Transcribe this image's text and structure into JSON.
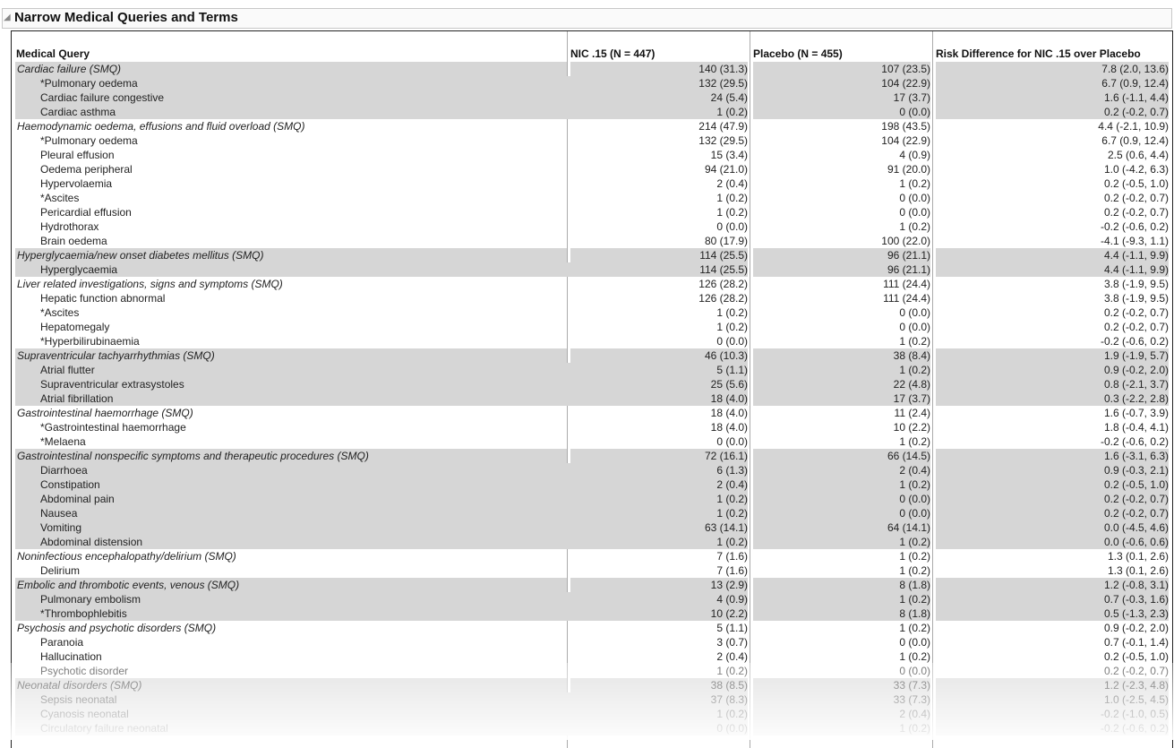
{
  "title": "Narrow Medical Queries and Terms",
  "headers": {
    "query": "Medical Query",
    "nic": "NIC .15 (N = 447)",
    "placebo": "Placebo (N = 455)",
    "risk": "Risk Difference for NIC .15 over Placebo"
  },
  "groups": [
    {
      "name": "Cardiac failure (SMQ)",
      "v": [
        "140 (31.3)",
        "107 (23.5)",
        "7.8 (2.0, 13.6)"
      ],
      "terms": [
        [
          "*Pulmonary oedema",
          "132 (29.5)",
          "104 (22.9)",
          "6.7 (0.9, 12.4)"
        ],
        [
          "Cardiac failure congestive",
          "24 (5.4)",
          "17 (3.7)",
          "1.6 (-1.1, 4.4)"
        ],
        [
          "Cardiac asthma",
          "1 (0.2)",
          "0 (0.0)",
          "0.2 (-0.2, 0.7)"
        ]
      ]
    },
    {
      "name": "Haemodynamic oedema, effusions and fluid overload (SMQ)",
      "v": [
        "214 (47.9)",
        "198 (43.5)",
        "4.4 (-2.1, 10.9)"
      ],
      "terms": [
        [
          "*Pulmonary oedema",
          "132 (29.5)",
          "104 (22.9)",
          "6.7 (0.9, 12.4)"
        ],
        [
          "Pleural effusion",
          "15 (3.4)",
          "4 (0.9)",
          "2.5 (0.6, 4.4)"
        ],
        [
          "Oedema peripheral",
          "94 (21.0)",
          "91 (20.0)",
          "1.0 (-4.2, 6.3)"
        ],
        [
          "Hypervolaemia",
          "2 (0.4)",
          "1 (0.2)",
          "0.2 (-0.5, 1.0)"
        ],
        [
          "*Ascites",
          "1 (0.2)",
          "0 (0.0)",
          "0.2 (-0.2, 0.7)"
        ],
        [
          "Pericardial effusion",
          "1 (0.2)",
          "0 (0.0)",
          "0.2 (-0.2, 0.7)"
        ],
        [
          "Hydrothorax",
          "0 (0.0)",
          "1 (0.2)",
          "-0.2 (-0.6, 0.2)"
        ],
        [
          "Brain oedema",
          "80 (17.9)",
          "100 (22.0)",
          "-4.1 (-9.3, 1.1)"
        ]
      ]
    },
    {
      "name": "Hyperglycaemia/new onset diabetes mellitus (SMQ)",
      "v": [
        "114 (25.5)",
        "96 (21.1)",
        "4.4 (-1.1, 9.9)"
      ],
      "terms": [
        [
          "Hyperglycaemia",
          "114 (25.5)",
          "96 (21.1)",
          "4.4 (-1.1, 9.9)"
        ]
      ]
    },
    {
      "name": "Liver related investigations, signs and symptoms (SMQ)",
      "v": [
        "126 (28.2)",
        "111 (24.4)",
        "3.8 (-1.9, 9.5)"
      ],
      "terms": [
        [
          "Hepatic function abnormal",
          "126 (28.2)",
          "111 (24.4)",
          "3.8 (-1.9, 9.5)"
        ],
        [
          "*Ascites",
          "1 (0.2)",
          "0 (0.0)",
          "0.2 (-0.2, 0.7)"
        ],
        [
          "Hepatomegaly",
          "1 (0.2)",
          "0 (0.0)",
          "0.2 (-0.2, 0.7)"
        ],
        [
          "*Hyperbilirubinaemia",
          "0 (0.0)",
          "1 (0.2)",
          "-0.2 (-0.6, 0.2)"
        ]
      ]
    },
    {
      "name": "Supraventricular tachyarrhythmias (SMQ)",
      "v": [
        "46 (10.3)",
        "38 (8.4)",
        "1.9 (-1.9, 5.7)"
      ],
      "terms": [
        [
          "Atrial flutter",
          "5 (1.1)",
          "1 (0.2)",
          "0.9 (-0.2, 2.0)"
        ],
        [
          "Supraventricular extrasystoles",
          "25 (5.6)",
          "22 (4.8)",
          "0.8 (-2.1, 3.7)"
        ],
        [
          "Atrial fibrillation",
          "18 (4.0)",
          "17 (3.7)",
          "0.3 (-2.2, 2.8)"
        ]
      ]
    },
    {
      "name": "Gastrointestinal haemorrhage (SMQ)",
      "v": [
        "18 (4.0)",
        "11 (2.4)",
        "1.6 (-0.7, 3.9)"
      ],
      "terms": [
        [
          "*Gastrointestinal haemorrhage",
          "18 (4.0)",
          "10 (2.2)",
          "1.8 (-0.4, 4.1)"
        ],
        [
          "*Melaena",
          "0 (0.0)",
          "1 (0.2)",
          "-0.2 (-0.6, 0.2)"
        ]
      ]
    },
    {
      "name": "Gastrointestinal nonspecific symptoms and therapeutic procedures (SMQ)",
      "v": [
        "72 (16.1)",
        "66 (14.5)",
        "1.6 (-3.1, 6.3)"
      ],
      "terms": [
        [
          "Diarrhoea",
          "6 (1.3)",
          "2 (0.4)",
          "0.9 (-0.3, 2.1)"
        ],
        [
          "Constipation",
          "2 (0.4)",
          "1 (0.2)",
          "0.2 (-0.5, 1.0)"
        ],
        [
          "Abdominal pain",
          "1 (0.2)",
          "0 (0.0)",
          "0.2 (-0.2, 0.7)"
        ],
        [
          "Nausea",
          "1 (0.2)",
          "0 (0.0)",
          "0.2 (-0.2, 0.7)"
        ],
        [
          "Vomiting",
          "63 (14.1)",
          "64 (14.1)",
          "0.0 (-4.5, 4.6)"
        ],
        [
          "Abdominal distension",
          "1 (0.2)",
          "1 (0.2)",
          "0.0 (-0.6, 0.6)"
        ]
      ]
    },
    {
      "name": "Noninfectious encephalopathy/delirium (SMQ)",
      "v": [
        "7 (1.6)",
        "1 (0.2)",
        "1.3 (0.1, 2.6)"
      ],
      "terms": [
        [
          "Delirium",
          "7 (1.6)",
          "1 (0.2)",
          "1.3 (0.1, 2.6)"
        ]
      ]
    },
    {
      "name": "Embolic and thrombotic events, venous (SMQ)",
      "v": [
        "13 (2.9)",
        "8 (1.8)",
        "1.2 (-0.8, 3.1)"
      ],
      "terms": [
        [
          "Pulmonary embolism",
          "4 (0.9)",
          "1 (0.2)",
          "0.7 (-0.3, 1.6)"
        ],
        [
          "*Thrombophlebitis",
          "10 (2.2)",
          "8 (1.8)",
          "0.5 (-1.3, 2.3)"
        ]
      ]
    },
    {
      "name": "Psychosis and psychotic disorders (SMQ)",
      "v": [
        "5 (1.1)",
        "1 (0.2)",
        "0.9 (-0.2, 2.0)"
      ],
      "terms": [
        [
          "Paranoia",
          "3 (0.7)",
          "0 (0.0)",
          "0.7 (-0.1, 1.4)"
        ],
        [
          "Hallucination",
          "2 (0.4)",
          "1 (0.2)",
          "0.2 (-0.5, 1.0)"
        ],
        [
          "Psychotic disorder",
          "1 (0.2)",
          "0 (0.0)",
          "0.2 (-0.2, 0.7)"
        ]
      ]
    },
    {
      "name": "Neonatal disorders (SMQ)",
      "v": [
        "38 (8.5)",
        "33 (7.3)",
        "1.2 (-2.3, 4.8)"
      ],
      "terms": [
        [
          "Sepsis neonatal",
          "37 (8.3)",
          "33 (7.3)",
          "1.0 (-2.5, 4.5)"
        ],
        [
          "Cyanosis neonatal",
          "1 (0.2)",
          "2 (0.4)",
          "-0.2 (-1.0, 0.5)"
        ],
        [
          "Circulatory failure neonatal",
          "0 (0.0)",
          "1 (0.2)",
          "-0.2 (-0.6, 0.2)"
        ]
      ]
    }
  ]
}
